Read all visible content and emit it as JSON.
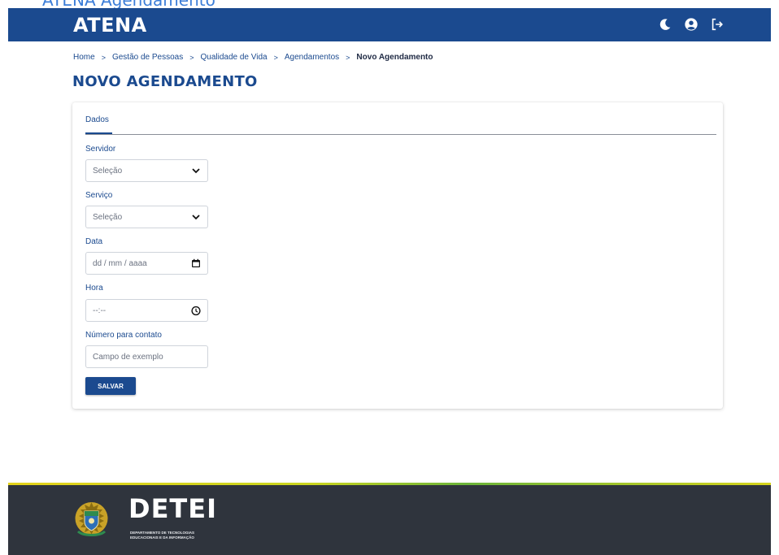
{
  "top_partial_text": "ATENA Agendamento",
  "header": {
    "logo": "ATENA",
    "icons": [
      "moon-icon",
      "user-circle-icon",
      "logout-icon"
    ],
    "background": "#1b4a8f"
  },
  "breadcrumb": {
    "items": [
      "Home",
      "Gestão de Pessoas",
      "Qualidade de Vida",
      "Agendamentos"
    ],
    "current": "Novo Agendamento",
    "separator": ">"
  },
  "page_title": "NOVO AGENDAMENTO",
  "form": {
    "tab_label": "Dados",
    "fields": [
      {
        "label": "Servidor",
        "type": "select",
        "value": "Seleção"
      },
      {
        "label": "Serviço",
        "type": "select",
        "value": "Seleção"
      },
      {
        "label": "Data",
        "type": "date",
        "value": "dd / mm / aaaa"
      },
      {
        "label": "Hora",
        "type": "time",
        "value": "--:--"
      },
      {
        "label": "Número para contato",
        "type": "text",
        "placeholder": "Campo de exemplo"
      }
    ],
    "save_label": "SALVAR"
  },
  "footer": {
    "brand": "DETEI",
    "subtitle_line1": "DEPARTAMENTO DE TECNOLOGIAS",
    "subtitle_line2": "EDUCACIONAIS E DA INFORMAÇÃO",
    "background": "#2f343d"
  }
}
